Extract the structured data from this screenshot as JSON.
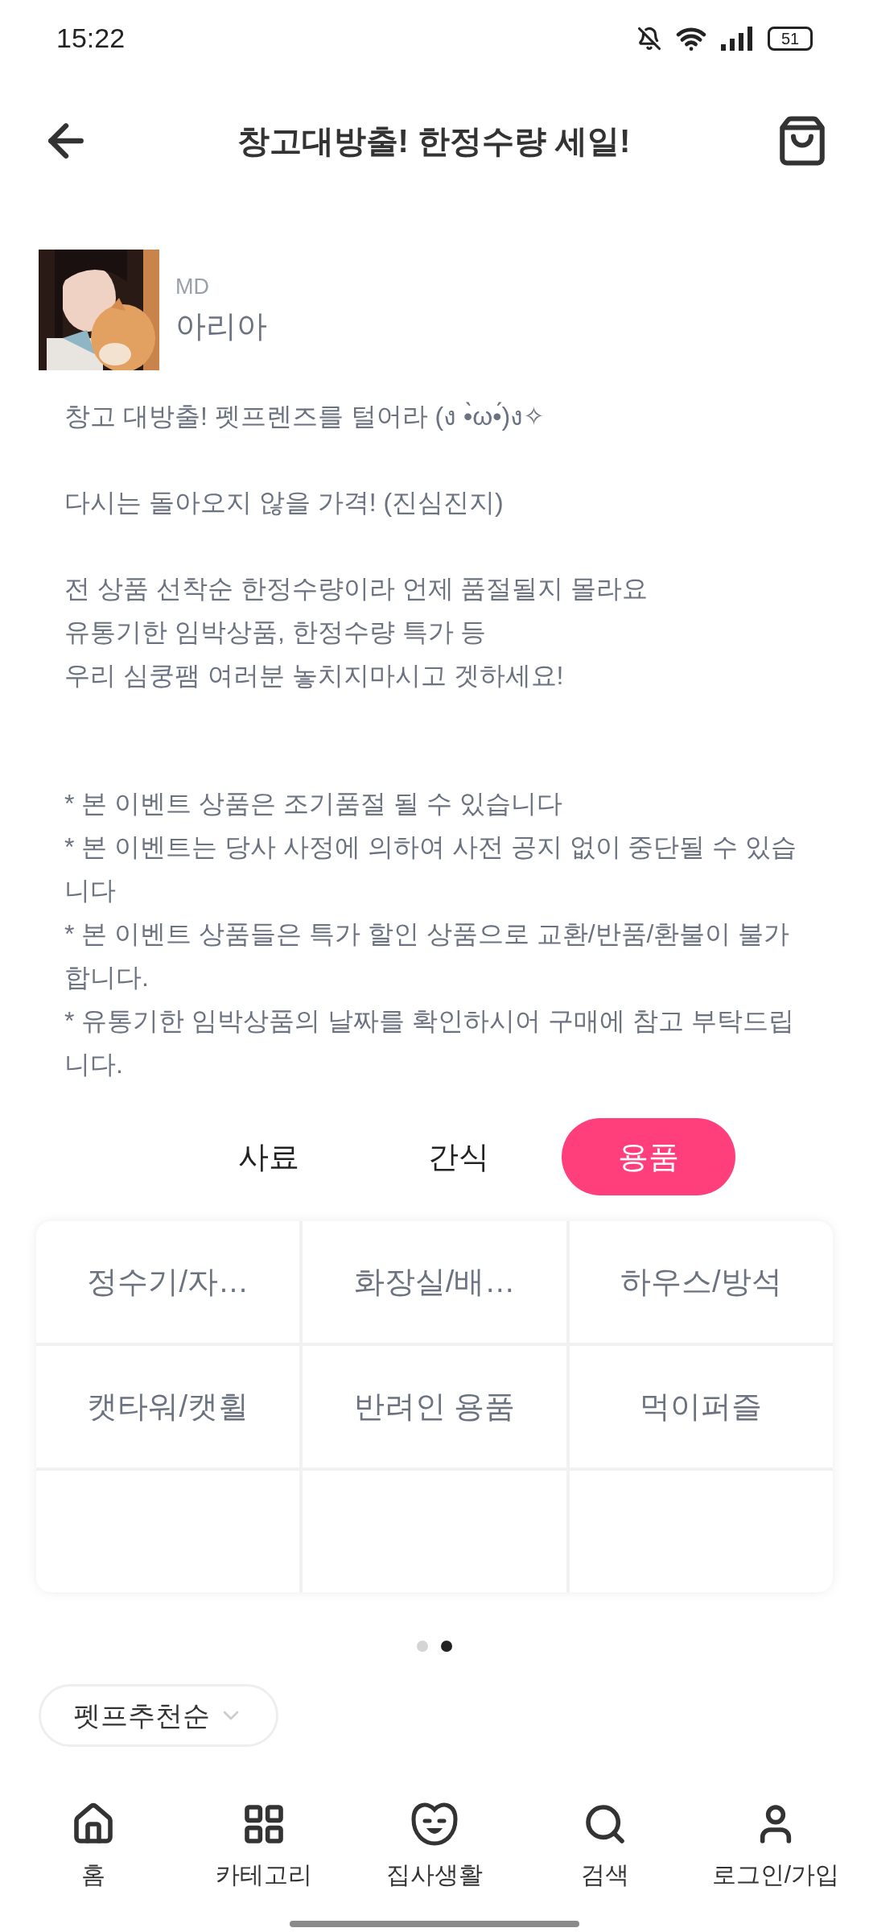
{
  "status_bar": {
    "time": "15:22",
    "battery": "51"
  },
  "header": {
    "title": "창고대방출! 한정수량 세일!"
  },
  "author": {
    "role": "MD",
    "name": "아리아"
  },
  "description": [
    {
      "kind": "para",
      "lines": [
        "창고 대방출! 펫프렌즈를 털어라 (ง •̀ω•́)ง✧"
      ]
    },
    {
      "kind": "para",
      "lines": [
        "다시는 돌아오지 않을 가격! (진심진지)"
      ]
    },
    {
      "kind": "para",
      "lines": [
        "전 상품 선착순 한정수량이라 언제 품절될지 몰라요",
        "유통기한 임박상품, 한정수량 특가 등",
        "우리 심쿵팸 여러분 놓치지마시고 겟하세요!"
      ]
    },
    {
      "kind": "notes",
      "lines": [
        "* 본 이벤트 상품은 조기품절 될 수 있습니다",
        "* 본 이벤트는 당사 사정에 의하여 사전 공지 없이 중단될 수 있습니다",
        "* 본 이벤트 상품들은 특가 할인 상품으로 교환/반품/환불이 불가합니다.",
        "* 유통기한 임박상품의 날짜를 확인하시어 구매에 참고 부탁드립니다."
      ]
    }
  ],
  "tabs": [
    {
      "label": "사료",
      "selected": false
    },
    {
      "label": "간식",
      "selected": false
    },
    {
      "label": "용품",
      "selected": true
    }
  ],
  "categories": [
    "정수기/자…",
    "화장실/배…",
    "하우스/방석",
    "캣타워/캣휠",
    "반려인 용품",
    "먹이퍼즐"
  ],
  "pager": [
    {
      "selected": false
    },
    {
      "selected": true
    }
  ],
  "sort": {
    "label": "펫프추천순"
  },
  "bottom_nav": [
    {
      "label": "홈"
    },
    {
      "label": "카테고리"
    },
    {
      "label": "집사생활"
    },
    {
      "label": "검색"
    },
    {
      "label": "로그인/가입"
    }
  ]
}
